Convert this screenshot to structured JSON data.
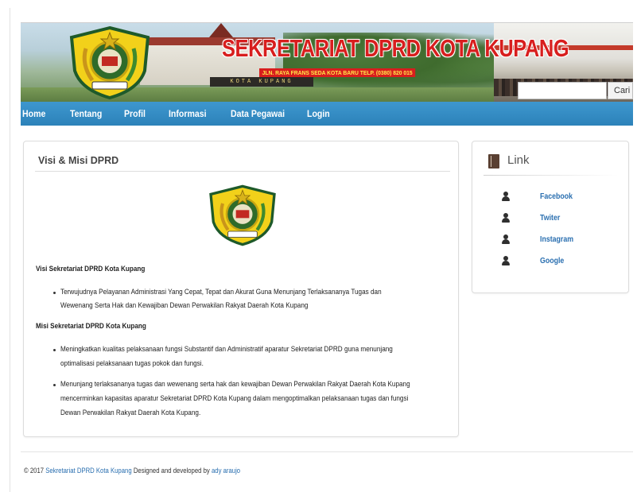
{
  "header": {
    "title": "SEKRETARIAT DPRD KOTA KUPANG",
    "address": "JLN. RAYA FRANS SEDA KOTA BARU TELP. (0380) 820 015",
    "sign_text": "KOTA KUPANG",
    "search_placeholder": "",
    "search_button": "Cari"
  },
  "nav": {
    "items": [
      "Home",
      "Tentang",
      "Profil",
      "Informasi",
      "Data Pegawai",
      "Login"
    ]
  },
  "main": {
    "heading": "Visi & Misi DPRD",
    "visi_heading": "Visi Sekretariat DPRD Kota Kupang",
    "visi_items": [
      "Terwujudnya Pelayanan Administrasi Yang Cepat, Tepat dan Akurat Guna Menunjang Terlaksananya   Tugas dan",
      "Wewenang Serta Hak dan Kewajiban Dewan Perwakilan Rakyat Daerah Kota Kupang"
    ],
    "misi_heading": "Misi Sekretariat DPRD Kota Kupang",
    "misi_item_1": [
      "Meningkatkan kualitas pelaksanaan fungsi Substantif dan Administratif aparatur Sekretariat DPRD guna menunjang",
      "optimalisasi pelaksanaan tugas pokok dan fungsi."
    ],
    "misi_item_2": [
      "Menunjang terlaksananya tugas dan wewenang serta hak dan kewajiban Dewan Perwakilan Rakyat Daerah Kota Kupang",
      "mencerminkan kapasitas aparatur Sekretariat DPRD Kota Kupang dalam mengoptimalkan pelaksanaan tugas dan fungsi",
      "Dewan Perwakilan Rakyat Daerah Kota Kupang."
    ]
  },
  "sidebar": {
    "heading": "Link",
    "links": [
      "Facebook",
      "Twiter",
      "Instagram",
      "Google"
    ]
  },
  "footer": {
    "prefix": "© 2017",
    "org_link": "Sekretariat DPRD Kota Kupang",
    "middle": "Designed and developed by",
    "author_link": "ady araujo"
  },
  "colors": {
    "nav_blue": "#2c82b9",
    "title_red": "#d81e1e",
    "link_blue": "#2a6fb0"
  }
}
